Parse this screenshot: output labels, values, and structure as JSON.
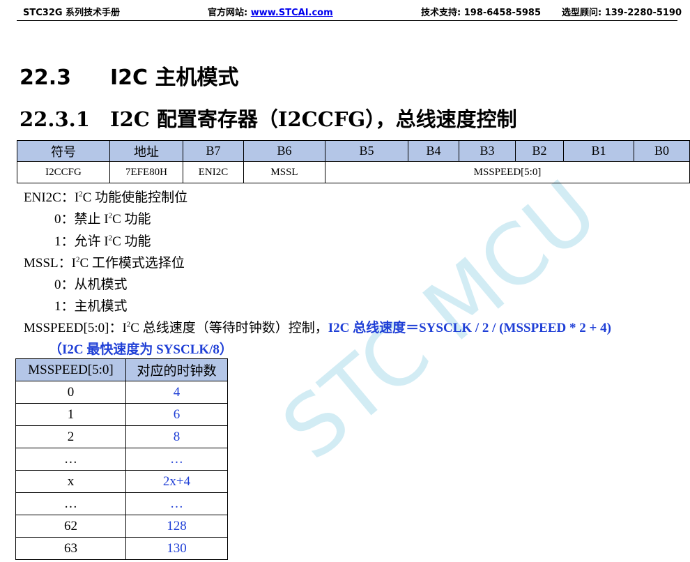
{
  "header": {
    "manual": "STC32G 系列技术手册",
    "site_label": "官方网站: ",
    "site_url": "www.STCAI.com",
    "support": "技术支持: 198-6458-5985",
    "advisor": "选型顾问: 139-2280-5190"
  },
  "section": {
    "num": "22.3",
    "title": "I2C 主机模式"
  },
  "subsection": {
    "num": "22.3.1",
    "title": "I2C 配置寄存器（I2CCFG），总线速度控制"
  },
  "register_table": {
    "headers": [
      "符号",
      "地址",
      "B7",
      "B6",
      "B5",
      "B4",
      "B3",
      "B2",
      "B1",
      "B0"
    ],
    "row": {
      "symbol": "I2CCFG",
      "address": "7EFE80H",
      "b7": "ENI2C",
      "b6": "MSSL",
      "b5_0": "MSSPEED[5:0]"
    }
  },
  "descriptions": {
    "eni2c_label": "ENI2C：I",
    "eni2c_rest": "C 功能使能控制位",
    "eni2c_0a": "0：禁止 I",
    "eni2c_0b": "C 功能",
    "eni2c_1a": "1：允许 I",
    "eni2c_1b": "C 功能",
    "mssl_label": "MSSL：I",
    "mssl_rest": "C 工作模式选择位",
    "mssl_0": "0：从机模式",
    "mssl_1": "1：主机模式",
    "msspeed_label": "MSSPEED[5:0]：I",
    "msspeed_rest": "C 总线速度（等待时钟数）控制，",
    "msspeed_formula": "I2C 总线速度＝SYSCLK / 2 / (MSSPEED * 2 + 4)",
    "msspeed_max": "（I2C 最快速度为 SYSCLK/8）",
    "superscript": "2"
  },
  "clock_table": {
    "headers": [
      "MSSPEED[5:0]",
      "对应的时钟数"
    ],
    "rows": [
      [
        "0",
        "4"
      ],
      [
        "1",
        "6"
      ],
      [
        "2",
        "8"
      ],
      [
        "…",
        "…"
      ],
      [
        "x",
        "2x+4"
      ],
      [
        "…",
        "…"
      ],
      [
        "62",
        "128"
      ],
      [
        "63",
        "130"
      ]
    ]
  },
  "watermark": "STC MCU"
}
